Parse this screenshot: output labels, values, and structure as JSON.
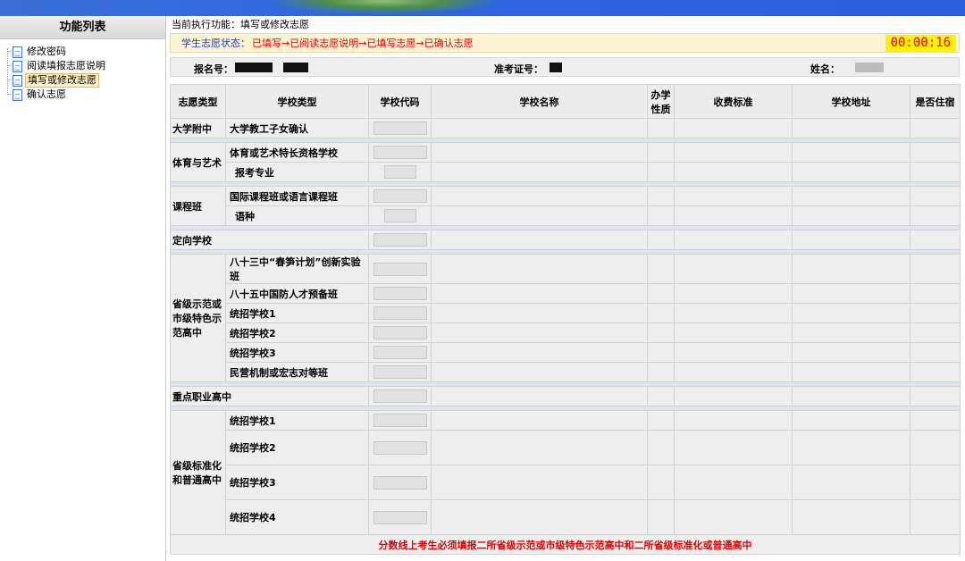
{
  "sidebar": {
    "title": "功能列表",
    "items": [
      {
        "label": "修改密码",
        "active": false
      },
      {
        "label": "阅读填报志愿说明",
        "active": false
      },
      {
        "label": "填写或修改志愿",
        "active": true
      },
      {
        "label": "确认志愿",
        "active": false
      }
    ]
  },
  "main": {
    "current_function": "当前执行功能：填写或修改志愿",
    "status_label": "学生志愿状态：",
    "status_value": "已填写→已阅读志愿说明→已填写志愿→已确认志愿",
    "timer": "00:00:16"
  },
  "info": {
    "reg_no_label": "报名号：",
    "exam_no_label": "准考证号：",
    "name_label": "姓名："
  },
  "table": {
    "headers": [
      "志愿类型",
      "学校类型",
      "学校代码",
      "学校名称",
      "办学性质",
      "收费标准",
      "学校地址",
      "是否住宿"
    ],
    "categories": {
      "daxue": "大学附中",
      "tiyu": "体育与艺术",
      "kecheng": "课程班",
      "dingxiang": "定向学校",
      "shengji": "省级示范或市级特色示范高中",
      "zhiye": "重点职业高中",
      "biaozhun": "省级标准化和普通高中"
    },
    "types": {
      "daxue_1": "大学教工子女确认",
      "tiyu_1": "体育或艺术特长资格学校",
      "tiyu_2": "报考专业",
      "kecheng_1": "国际课程班或语言课程班",
      "kecheng_2": "语种",
      "shengji_1": "八十三中“春笋计划”创新实验班",
      "shengji_2": "八十五中国防人才预备班",
      "shengji_3": "统招学校1",
      "shengji_4": "统招学校2",
      "shengji_5": "统招学校3",
      "shengji_6": "民营机制或宏志对等班",
      "biaozhun_1": "统招学校1",
      "biaozhun_2": "统招学校2",
      "biaozhun_3": "统招学校3",
      "biaozhun_4": "统招学校4"
    },
    "note": "分数线上考生必须填报二所省级示范或市级特色示范高中和二所省级标准化或普通高中"
  }
}
